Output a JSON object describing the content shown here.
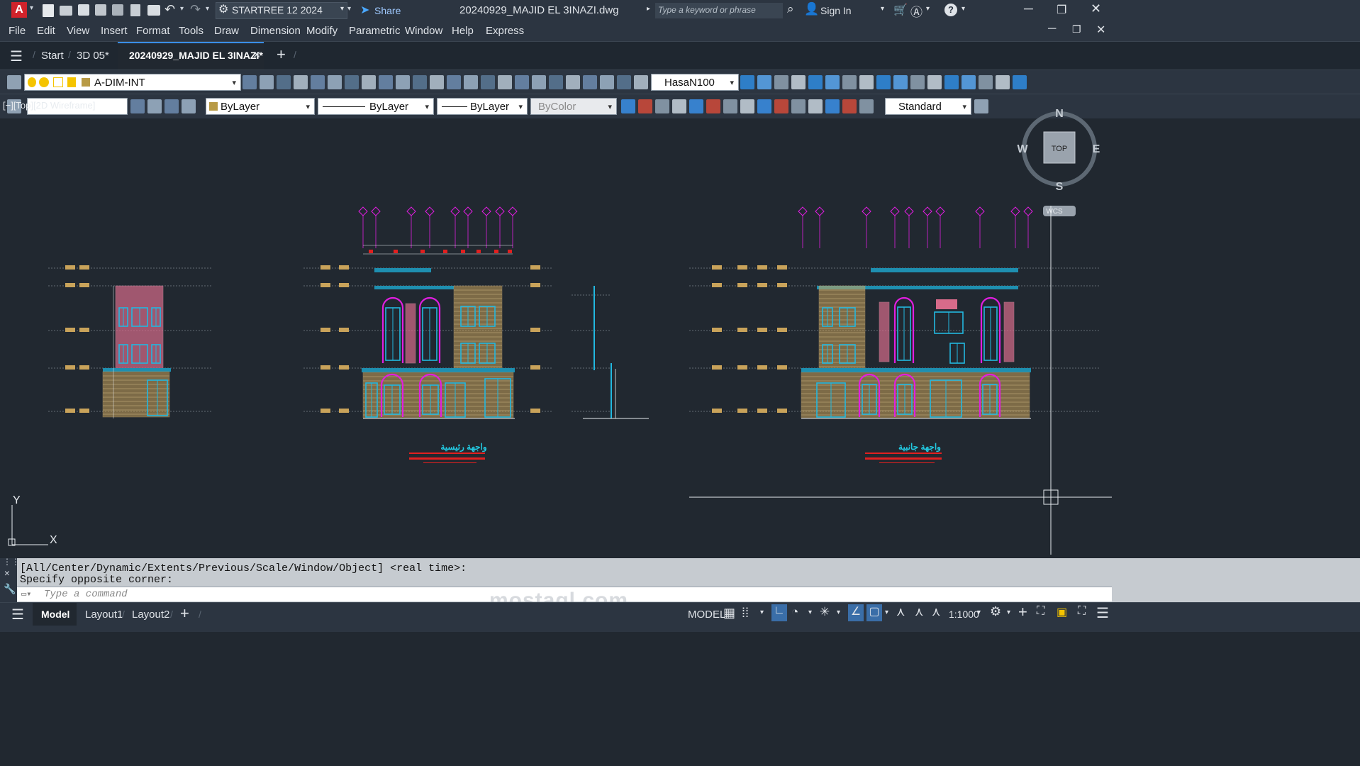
{
  "titlebar": {
    "app_logo": "A",
    "workspace": "STARTREE 12 2024",
    "share": "Share",
    "file_title": "20240929_MAJID EL 3INAZI.dwg",
    "search_placeholder": "Type a keyword or phrase",
    "sign_in": "Sign In"
  },
  "menu": [
    "File",
    "Edit",
    "View",
    "Insert",
    "Format",
    "Tools",
    "Draw",
    "Dimension",
    "Modify",
    "Parametric",
    "Window",
    "Help",
    "Express"
  ],
  "tabs": {
    "start": "Start",
    "tab1": "3D 05*",
    "active": "20240929_MAJID EL 3INAZI*"
  },
  "toolbar1": {
    "layer": "A-DIM-INT",
    "dimstyle": "HasaN100"
  },
  "toolbar2": {
    "color": "ByLayer",
    "linetype": "ByLayer",
    "lineweight": "ByLayer",
    "plotstyle": "ByColor",
    "textstyle": "Standard"
  },
  "viewport": {
    "label": "[−][Top][2D Wireframe]",
    "compass": {
      "n": "N",
      "s": "S",
      "e": "E",
      "w": "W",
      "top": "TOP",
      "wcs": "WCS"
    },
    "ucs": {
      "x": "X",
      "y": "Y"
    }
  },
  "drawing": {
    "elev1_title": "واجهة رئيسية",
    "elev2_title": "واجهة جانبية",
    "grid_front": [
      "I",
      "H",
      "G",
      "F",
      "E",
      "D",
      "C",
      "B",
      "A"
    ],
    "grid_side": [
      "1",
      "2",
      "3",
      "4",
      "5",
      "6",
      "7",
      "8",
      "9",
      "10"
    ]
  },
  "command": {
    "line1": "[All/Center/Dynamic/Extents/Previous/Scale/Window/Object] <real time>:",
    "line2": "Specify opposite corner:",
    "placeholder": "Type a command"
  },
  "watermark": "mostaql.com",
  "status": {
    "model_tab": "Model",
    "layout1": "Layout1",
    "layout2": "Layout2",
    "model": "MODEL",
    "scale": "1:1000"
  },
  "colors": {
    "canvas": "#212830",
    "magenta": "#e01ee0",
    "cyan": "#22b8e0",
    "brick": "#c9a35a",
    "red": "#e02020"
  }
}
